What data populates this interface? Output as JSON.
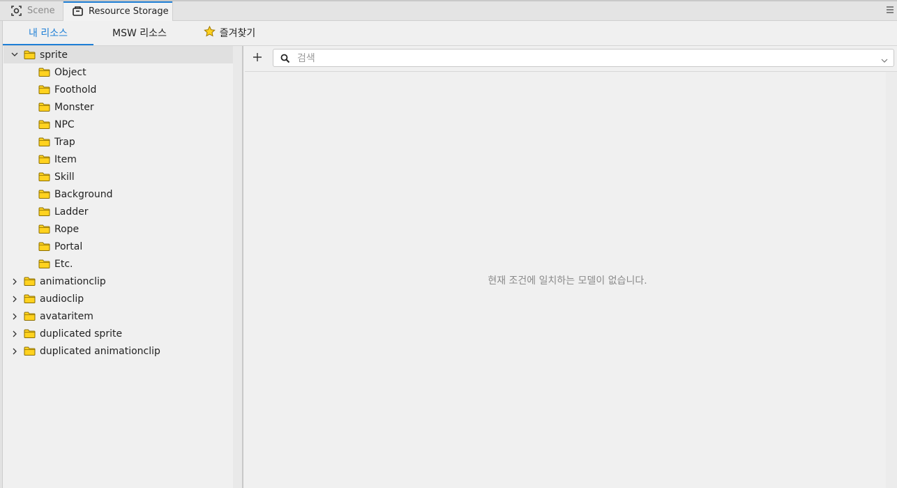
{
  "tabs": [
    {
      "label": "Scene",
      "icon": "scene-icon",
      "active": false
    },
    {
      "label": "Resource Storage",
      "icon": "storage-icon",
      "active": true
    }
  ],
  "subtabs": [
    {
      "label": "내 리소스",
      "active": true
    },
    {
      "label": "MSW 리소스",
      "active": false
    },
    {
      "label": "즐겨찾기",
      "icon": "star-icon",
      "active": false
    }
  ],
  "tree": {
    "root": {
      "label": "sprite",
      "expanded": true
    },
    "children": [
      "Object",
      "Foothold",
      "Monster",
      "NPC",
      "Trap",
      "Item",
      "Skill",
      "Background",
      "Ladder",
      "Rope",
      "Portal",
      "Etc."
    ],
    "collapsed": [
      "animationclip",
      "audioclip",
      "avataritem",
      "duplicated sprite",
      "duplicated animationclip"
    ]
  },
  "search": {
    "placeholder": "검색",
    "value": ""
  },
  "empty_message": "현재 조건에 일치하는 모델이 없습니다.",
  "colors": {
    "accent": "#1e7fd6",
    "folder": "#ffd21f",
    "folder_border": "#8a6d00",
    "star": "#ffd21f"
  }
}
